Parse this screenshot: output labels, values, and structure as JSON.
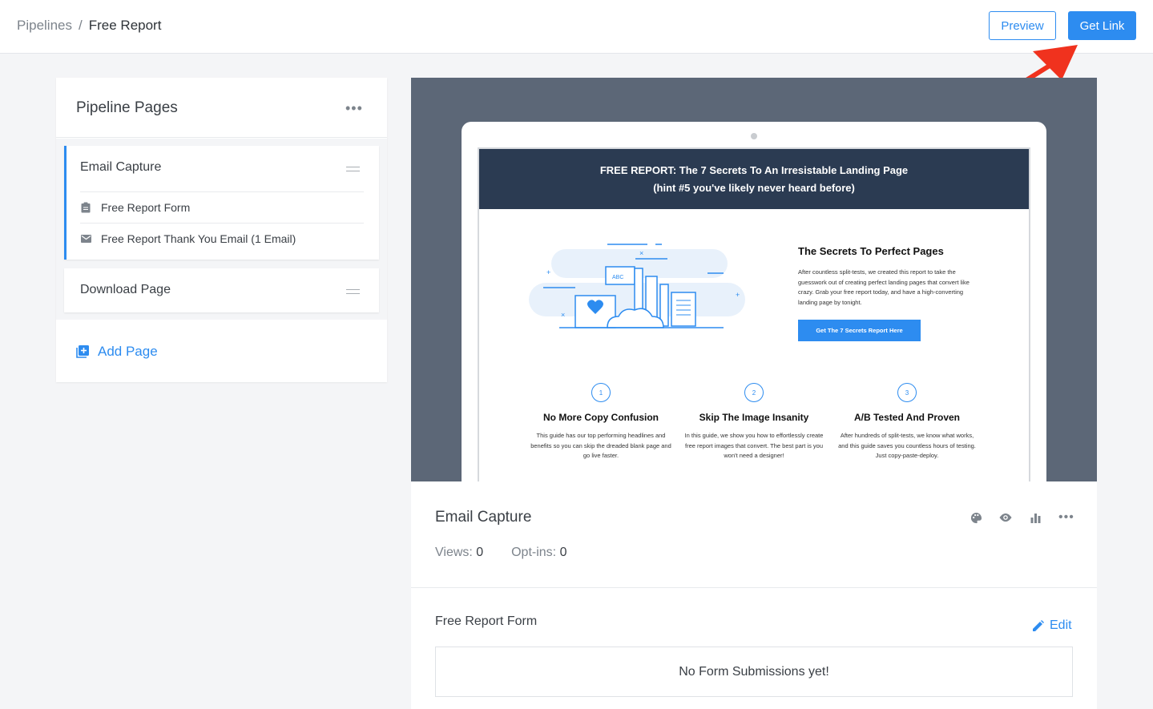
{
  "breadcrumb": {
    "parent": "Pipelines",
    "separator": "/",
    "current": "Free Report"
  },
  "header": {
    "preview_label": "Preview",
    "get_link_label": "Get Link"
  },
  "sidebar": {
    "title": "Pipeline Pages",
    "pages": [
      {
        "title": "Email Capture",
        "items": [
          {
            "icon": "clipboard-icon",
            "label": "Free Report Form"
          },
          {
            "icon": "envelope-icon",
            "label": "Free Report Thank You Email (1 Email)"
          }
        ]
      },
      {
        "title": "Download Page",
        "items": []
      }
    ],
    "add_page_label": "Add Page"
  },
  "preview": {
    "headline": "FREE REPORT: The 7 Secrets To An Irresistable Landing Page (hint #5 you've likely never heard before)",
    "section_heading": "The Secrets To Perfect Pages",
    "section_text": "After countless split-tests, we created this report to take the guesswork out of creating perfect landing pages that convert like crazy. Grab your free report today, and have a high-converting landing page by tonight.",
    "cta_label": "Get The 7 Secrets Report Here",
    "illustration_label": "ABC",
    "features": [
      {
        "num": "1",
        "title": "No More Copy Confusion",
        "text": "This guide has our top performing headlines and benefits so you can skip the dreaded blank page and go live faster."
      },
      {
        "num": "2",
        "title": "Skip The Image Insanity",
        "text": "In this guide, we show you how to effortlessly create free report images that convert. The best part is you won't need a designer!"
      },
      {
        "num": "3",
        "title": "A/B Tested And Proven",
        "text": "After hundreds of split-tests, we know what works, and this guide saves you countless hours of testing. Just copy-paste-deploy."
      }
    ]
  },
  "page_info": {
    "title": "Email Capture",
    "views_label": "Views:",
    "views_value": "0",
    "optins_label": "Opt-ins:",
    "optins_value": "0",
    "icons": [
      "palette-icon",
      "eye-icon",
      "bar-chart-icon",
      "more-icon"
    ]
  },
  "form_section": {
    "title": "Free Report Form",
    "edit_label": "Edit",
    "empty_message": "No Form Submissions yet!"
  },
  "colors": {
    "accent": "#2d8cf0",
    "annotation_arrow": "#f0321e",
    "preview_bg": "#5c6777",
    "landing_header": "#2b3b52"
  }
}
